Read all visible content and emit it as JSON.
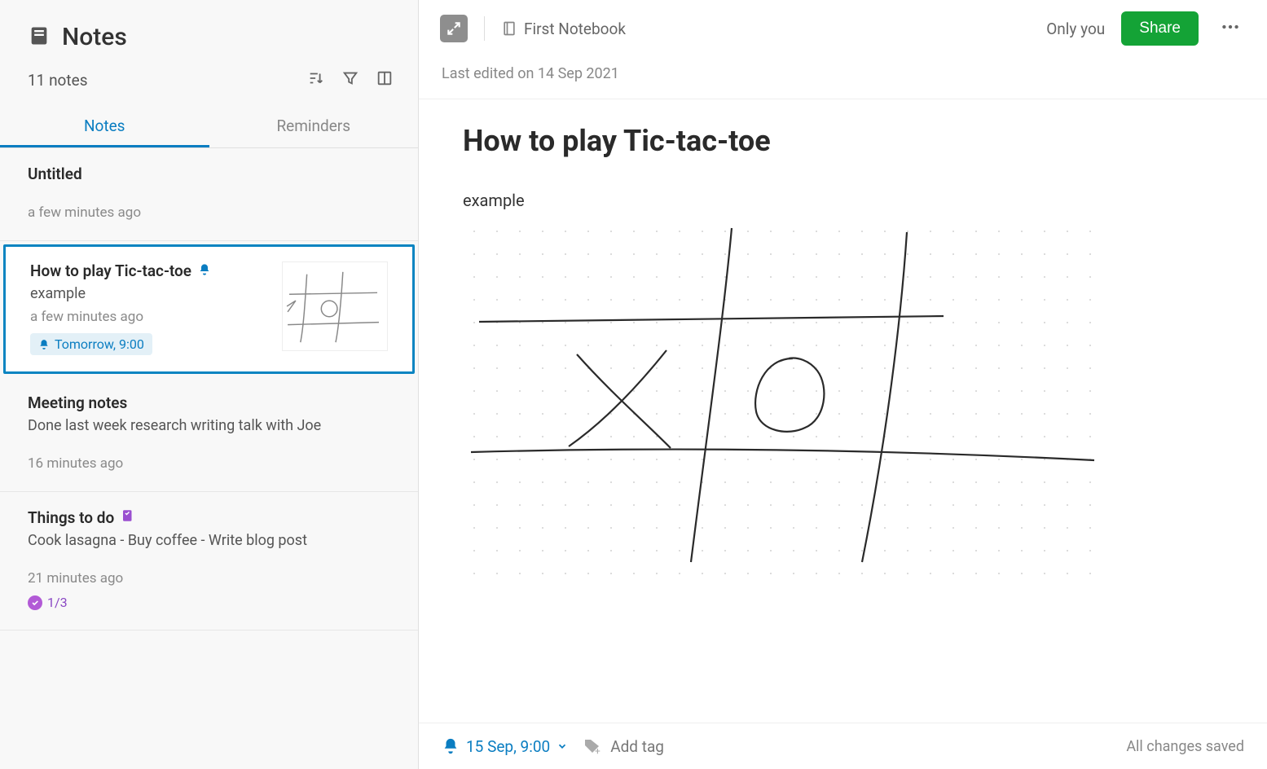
{
  "sidebar": {
    "title": "Notes",
    "count_label": "11 notes",
    "tabs": {
      "notes": "Notes",
      "reminders": "Reminders"
    }
  },
  "notes": [
    {
      "title": "Untitled",
      "snippet": "",
      "time": "a few minutes ago"
    },
    {
      "title": "How to play Tic-tac-toe",
      "snippet": "example",
      "time": "a few minutes ago",
      "reminder_chip": "Tomorrow, 9:00",
      "selected": true,
      "has_thumb": true,
      "has_bell": true
    },
    {
      "title": "Meeting notes",
      "snippet": "Done last week research writing talk with Joe",
      "time": "16 minutes ago"
    },
    {
      "title": "Things to do",
      "snippet": "Cook lasagna - Buy coffee - Write blog post",
      "time": "21 minutes ago",
      "task_progress": "1/3",
      "has_tasks_icon": true
    }
  ],
  "topbar": {
    "notebook": "First Notebook",
    "only_you": "Only you",
    "share": "Share"
  },
  "edited": "Last edited on 14 Sep 2021",
  "doc": {
    "title": "How to play Tic-tac-toe",
    "body": "example"
  },
  "bottombar": {
    "reminder": "15 Sep, 9:00",
    "add_tag": "Add tag",
    "saved": "All changes saved"
  },
  "colors": {
    "accent_blue": "#0a7dc1",
    "share_green": "#14a336",
    "task_purple": "#9a4fd0"
  }
}
